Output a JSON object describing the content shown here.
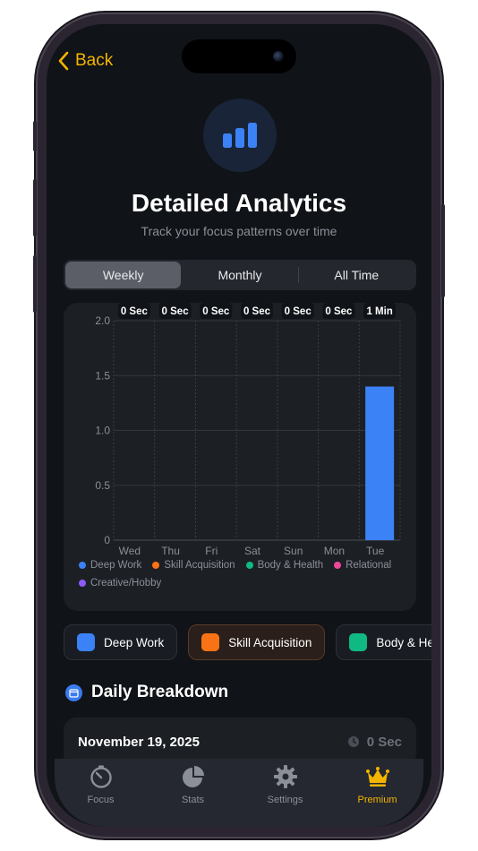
{
  "nav": {
    "back_label": "Back"
  },
  "header": {
    "title": "Detailed Analytics",
    "subtitle": "Track your focus patterns over time"
  },
  "period_tabs": [
    {
      "label": "Weekly",
      "active": true
    },
    {
      "label": "Monthly",
      "active": false
    },
    {
      "label": "All Time",
      "active": false
    }
  ],
  "chart_data": {
    "type": "bar",
    "categories": [
      "Wed",
      "Thu",
      "Fri",
      "Sat",
      "Sun",
      "Mon",
      "Tue"
    ],
    "values": [
      0,
      0,
      0,
      0,
      0,
      0,
      1.4
    ],
    "value_labels": [
      "0 Sec",
      "0 Sec",
      "0 Sec",
      "0 Sec",
      "0 Sec",
      "0 Sec",
      "1 Min"
    ],
    "yticks": [
      "0",
      "0.5",
      "1.0",
      "1.5",
      "2.0"
    ],
    "ylim": [
      0,
      2.0
    ],
    "bar_color": "#3b82f6",
    "grid": true,
    "legend_position": "bottom",
    "legend": [
      {
        "name": "Deep Work",
        "color": "#3b82f6"
      },
      {
        "name": "Skill Acquisition",
        "color": "#f97316"
      },
      {
        "name": "Body & Health",
        "color": "#10b981"
      },
      {
        "name": "Relational",
        "color": "#ec4899"
      },
      {
        "name": "Creative/Hobby",
        "color": "#8b5cf6"
      }
    ]
  },
  "categories": [
    {
      "label": "Deep Work",
      "color": "#3b82f6",
      "selected": false
    },
    {
      "label": "Skill Acquisition",
      "color": "#f97316",
      "selected": true
    },
    {
      "label": "Body & Health",
      "color": "#10b981",
      "selected": false
    }
  ],
  "breakdown": {
    "title": "Daily Breakdown",
    "rows": [
      {
        "date": "November 19, 2025",
        "duration": "0 Sec"
      }
    ]
  },
  "tabbar": {
    "items": [
      {
        "label": "Focus",
        "icon": "timer-icon",
        "active": false
      },
      {
        "label": "Stats",
        "icon": "pie-chart-icon",
        "active": false
      },
      {
        "label": "Settings",
        "icon": "gear-icon",
        "active": false
      },
      {
        "label": "Premium",
        "icon": "crown-icon",
        "active": true
      }
    ]
  },
  "colors": {
    "accent": "#f4b400",
    "background": "#101318",
    "card": "#1c1f24"
  }
}
